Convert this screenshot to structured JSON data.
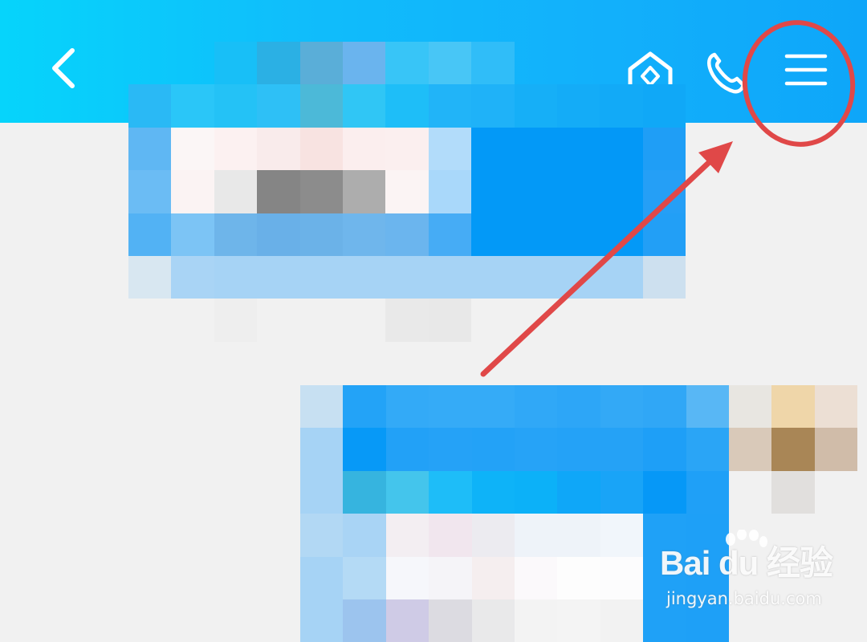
{
  "header": {
    "background_start": "#06d4fb",
    "background_end": "#0ea6f9",
    "icons": {
      "back": "chevron-left-icon",
      "home": "home-icon",
      "call": "phone-icon",
      "menu": "hamburger-menu-icon"
    }
  },
  "annotation": {
    "color": "#e04848",
    "shapes": [
      "circle-around-menu",
      "arrow-to-menu"
    ]
  },
  "watermark": {
    "brand_text": "Bai du 经验",
    "url_text": "jingyan.baidu.com"
  }
}
